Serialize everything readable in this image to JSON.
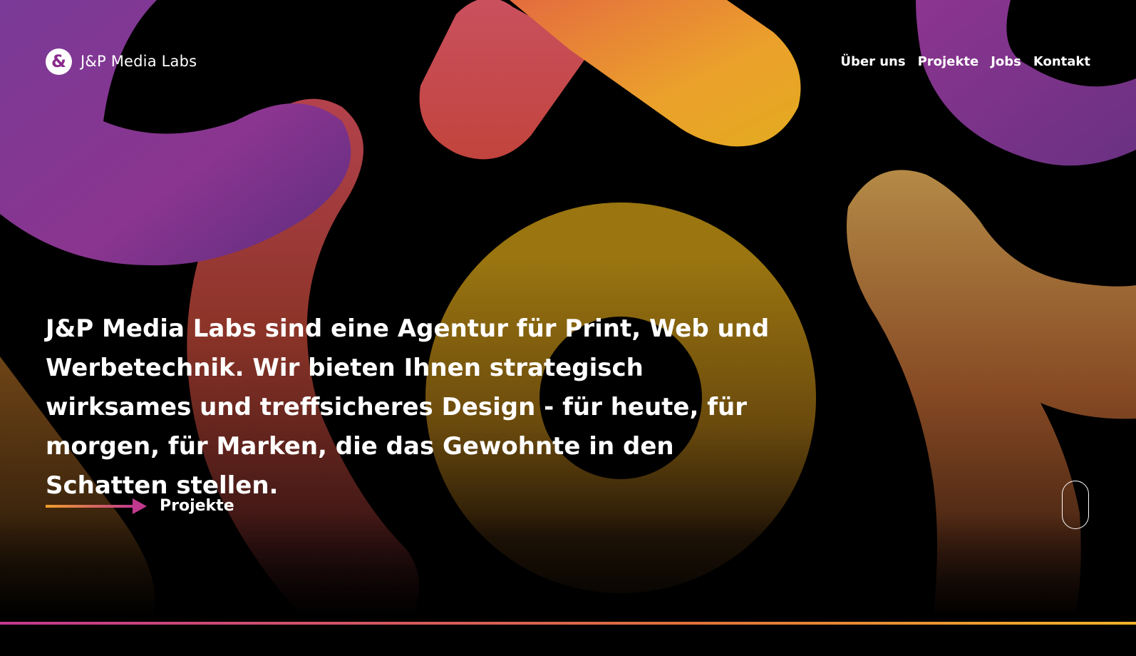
{
  "header": {
    "logo_glyph": "&",
    "brand_name": "J&P Media Labs",
    "nav": [
      {
        "label": "Über uns"
      },
      {
        "label": "Projekte"
      },
      {
        "label": "Jobs"
      },
      {
        "label": "Kontakt"
      }
    ]
  },
  "hero": {
    "headline": "J&P Media Labs sind eine Agentur für Print, Web und Werbetechnik. Wir bieten Ihnen strategisch wirksames und treffsicheres Design - für heute, für morgen, für Marken, die das Gewohnte in den Schatten stellen.",
    "cta_label": "Projekte"
  },
  "colors": {
    "background": "#000000",
    "purple": "#8b3a9e",
    "magenta": "#c1398f",
    "red": "#c94f5a",
    "orange": "#e7782f",
    "gold": "#e8b126",
    "olive": "#9a7510"
  },
  "icons": {
    "logo": "ampersand-logo-icon",
    "cta": "arrow-right-icon",
    "scroll": "scroll-mouse-icon"
  }
}
